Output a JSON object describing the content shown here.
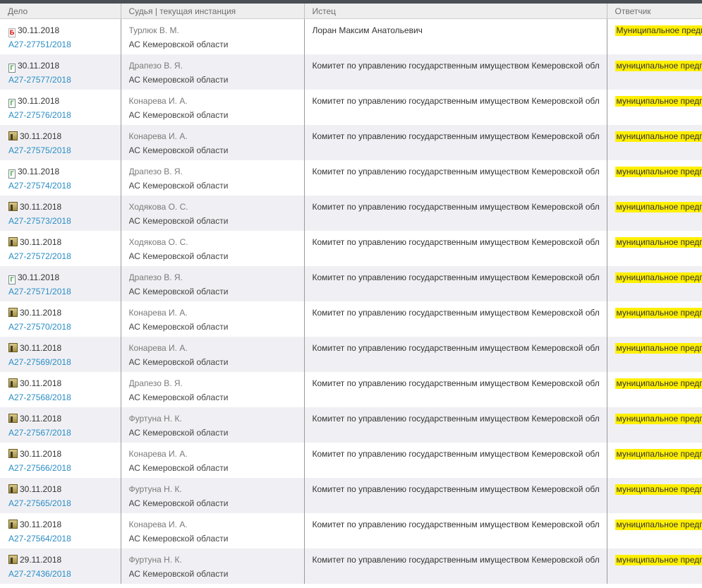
{
  "headers": {
    "case": "Дело",
    "judge": "Судья | текущая инстанция",
    "plaintiff": "Истец",
    "respondent": "Ответчик"
  },
  "colors": {
    "link": "#2a8dc5",
    "highlight": "#ffef00",
    "header_bg": "#eeeeee",
    "row_alt_bg": "#f0f0f4"
  },
  "rows": [
    {
      "icon": "document-b-icon",
      "icon_text": "Б",
      "date": "30.11.2018",
      "case_no": "А27-27751/2018",
      "judge": "Турлюк В. М.",
      "court": "АС Кемеровской области",
      "plaintiff": "Лоран Максим Анатольевич",
      "respondent": "Муниципальное предп"
    },
    {
      "icon": "document-g-icon",
      "icon_text": "Г",
      "date": "30.11.2018",
      "case_no": "А27-27577/2018",
      "judge": "Драпезо В. Я.",
      "court": "АС Кемеровской области",
      "plaintiff": "Комитет по управлению государственным имуществом Кемеровской обл",
      "respondent": "муниципальное предп"
    },
    {
      "icon": "document-g-icon",
      "icon_text": "Г",
      "date": "30.11.2018",
      "case_no": "А27-27576/2018",
      "judge": "Конарева И. А.",
      "court": "АС Кемеровской области",
      "plaintiff": "Комитет по управлению государственным имуществом Кемеровской обл",
      "respondent": "муниципальное предп"
    },
    {
      "icon": "folder-icon",
      "icon_text": "",
      "date": "30.11.2018",
      "case_no": "А27-27575/2018",
      "judge": "Конарева И. А.",
      "court": "АС Кемеровской области",
      "plaintiff": "Комитет по управлению государственным имуществом Кемеровской обл",
      "respondent": "муниципальное предп"
    },
    {
      "icon": "document-g-icon",
      "icon_text": "Г",
      "date": "30.11.2018",
      "case_no": "А27-27574/2018",
      "judge": "Драпезо В. Я.",
      "court": "АС Кемеровской области",
      "plaintiff": "Комитет по управлению государственным имуществом Кемеровской обл",
      "respondent": "муниципальное предп"
    },
    {
      "icon": "folder-icon",
      "icon_text": "",
      "date": "30.11.2018",
      "case_no": "А27-27573/2018",
      "judge": "Ходякова О. С.",
      "court": "АС Кемеровской области",
      "plaintiff": "Комитет по управлению государственным имуществом Кемеровской обл",
      "respondent": "муниципальное предп"
    },
    {
      "icon": "folder-icon",
      "icon_text": "",
      "date": "30.11.2018",
      "case_no": "А27-27572/2018",
      "judge": "Ходякова О. С.",
      "court": "АС Кемеровской области",
      "plaintiff": "Комитет по управлению государственным имуществом Кемеровской обл",
      "respondent": "муниципальное предп"
    },
    {
      "icon": "document-g-icon",
      "icon_text": "Г",
      "date": "30.11.2018",
      "case_no": "А27-27571/2018",
      "judge": "Драпезо В. Я.",
      "court": "АС Кемеровской области",
      "plaintiff": "Комитет по управлению государственным имуществом Кемеровской обл",
      "respondent": "муниципальное предп"
    },
    {
      "icon": "folder-icon",
      "icon_text": "",
      "date": "30.11.2018",
      "case_no": "А27-27570/2018",
      "judge": "Конарева И. А.",
      "court": "АС Кемеровской области",
      "plaintiff": "Комитет по управлению государственным имуществом Кемеровской обл",
      "respondent": "муниципальное предп"
    },
    {
      "icon": "folder-icon",
      "icon_text": "",
      "date": "30.11.2018",
      "case_no": "А27-27569/2018",
      "judge": "Конарева И. А.",
      "court": "АС Кемеровской области",
      "plaintiff": "Комитет по управлению государственным имуществом Кемеровской обл",
      "respondent": "муниципальное предп"
    },
    {
      "icon": "folder-icon",
      "icon_text": "",
      "date": "30.11.2018",
      "case_no": "А27-27568/2018",
      "judge": "Драпезо В. Я.",
      "court": "АС Кемеровской области",
      "plaintiff": "Комитет по управлению государственным имуществом Кемеровской обл",
      "respondent": "муниципальное предп"
    },
    {
      "icon": "folder-icon",
      "icon_text": "",
      "date": "30.11.2018",
      "case_no": "А27-27567/2018",
      "judge": "Фуртуна Н. К.",
      "court": "АС Кемеровской области",
      "plaintiff": "Комитет по управлению государственным имуществом Кемеровской обл",
      "respondent": "муниципальное предп"
    },
    {
      "icon": "folder-icon",
      "icon_text": "",
      "date": "30.11.2018",
      "case_no": "А27-27566/2018",
      "judge": "Конарева И. А.",
      "court": "АС Кемеровской области",
      "plaintiff": "Комитет по управлению государственным имуществом Кемеровской обл",
      "respondent": "муниципальное предп"
    },
    {
      "icon": "folder-icon",
      "icon_text": "",
      "date": "30.11.2018",
      "case_no": "А27-27565/2018",
      "judge": "Фуртуна Н. К.",
      "court": "АС Кемеровской области",
      "plaintiff": "Комитет по управлению государственным имуществом Кемеровской обл",
      "respondent": "муниципальное предп"
    },
    {
      "icon": "folder-icon",
      "icon_text": "",
      "date": "30.11.2018",
      "case_no": "А27-27564/2018",
      "judge": "Конарева И. А.",
      "court": "АС Кемеровской области",
      "plaintiff": "Комитет по управлению государственным имуществом Кемеровской обл",
      "respondent": "муниципальное предп"
    },
    {
      "icon": "folder-icon",
      "icon_text": "",
      "date": "29.11.2018",
      "case_no": "А27-27436/2018",
      "judge": "Фуртуна Н. К.",
      "court": "АС Кемеровской области",
      "plaintiff": "Комитет по управлению государственным имуществом Кемеровской обл",
      "respondent": "муниципальное предп"
    }
  ]
}
